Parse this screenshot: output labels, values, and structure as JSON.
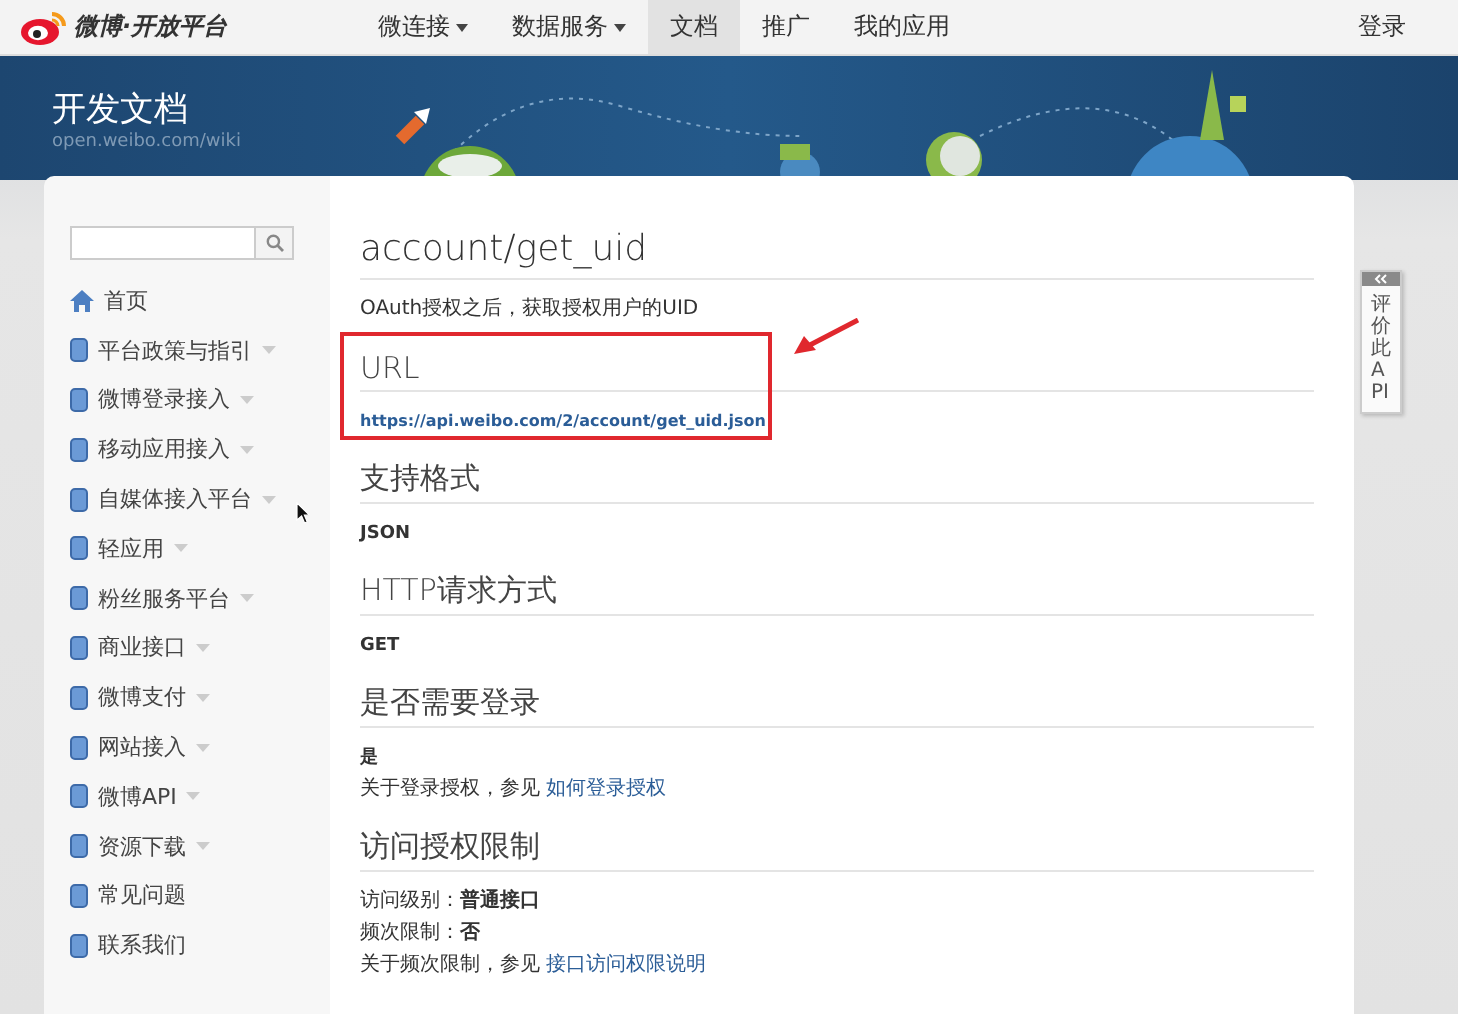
{
  "nav": {
    "logo": "微博·开放平台",
    "items": [
      {
        "label": "微连接",
        "dropdown": true,
        "selected": false
      },
      {
        "label": "数据服务",
        "dropdown": true,
        "selected": false
      },
      {
        "label": "文档",
        "dropdown": false,
        "selected": true
      },
      {
        "label": "推广",
        "dropdown": false,
        "selected": false
      },
      {
        "label": "我的应用",
        "dropdown": false,
        "selected": false
      }
    ],
    "login": "登录"
  },
  "banner": {
    "title": "开发文档",
    "subtitle": "open.weibo.com/wiki"
  },
  "sidebar": {
    "items": [
      {
        "label": "首页",
        "kind": "home",
        "expandable": false
      },
      {
        "label": "平台政策与指引",
        "kind": "folder",
        "expandable": true
      },
      {
        "label": "微博登录接入",
        "kind": "folder",
        "expandable": true
      },
      {
        "label": "移动应用接入",
        "kind": "folder",
        "expandable": true
      },
      {
        "label": "自媒体接入平台",
        "kind": "folder",
        "expandable": true
      },
      {
        "label": "轻应用",
        "kind": "folder",
        "expandable": true
      },
      {
        "label": "粉丝服务平台",
        "kind": "folder",
        "expandable": true
      },
      {
        "label": "商业接口",
        "kind": "folder",
        "expandable": true
      },
      {
        "label": "微博支付",
        "kind": "folder",
        "expandable": true
      },
      {
        "label": "网站接入",
        "kind": "folder",
        "expandable": true
      },
      {
        "label": "微博API",
        "kind": "folder",
        "expandable": true
      },
      {
        "label": "资源下载",
        "kind": "folder",
        "expandable": true
      },
      {
        "label": "常见问题",
        "kind": "folder",
        "expandable": false
      },
      {
        "label": "联系我们",
        "kind": "folder",
        "expandable": false
      }
    ]
  },
  "doc": {
    "title": "account/get_uid",
    "description": "OAuth授权之后，获取授权用户的UID",
    "sections": [
      {
        "heading": "URL",
        "highlighted": true,
        "lines": [
          {
            "kind": "link",
            "text": "https://api.weibo.com/2/account/get_uid.json"
          }
        ]
      },
      {
        "heading": "支持格式",
        "highlighted": false,
        "lines": [
          {
            "kind": "bold",
            "text": "JSON"
          }
        ]
      },
      {
        "heading": "HTTP请求方式",
        "highlighted": false,
        "lines": [
          {
            "kind": "bold",
            "text": "GET"
          }
        ]
      },
      {
        "heading": "是否需要登录",
        "highlighted": false,
        "lines": [
          {
            "kind": "bold",
            "text": "是"
          },
          {
            "kind": "note",
            "text": "关于登录授权，参见 ",
            "link": "如何登录授权"
          }
        ]
      },
      {
        "heading": "访问授权限制",
        "highlighted": false,
        "lines": [
          {
            "kind": "plain",
            "text": "访问级别：**普通接口**"
          },
          {
            "kind": "plain",
            "text": "频次限制：**否**"
          },
          {
            "kind": "note",
            "text": "关于频次限制，参见 ",
            "link": "接口访问权限说明"
          }
        ]
      }
    ]
  },
  "rate_tab": {
    "label": "评价此API"
  }
}
